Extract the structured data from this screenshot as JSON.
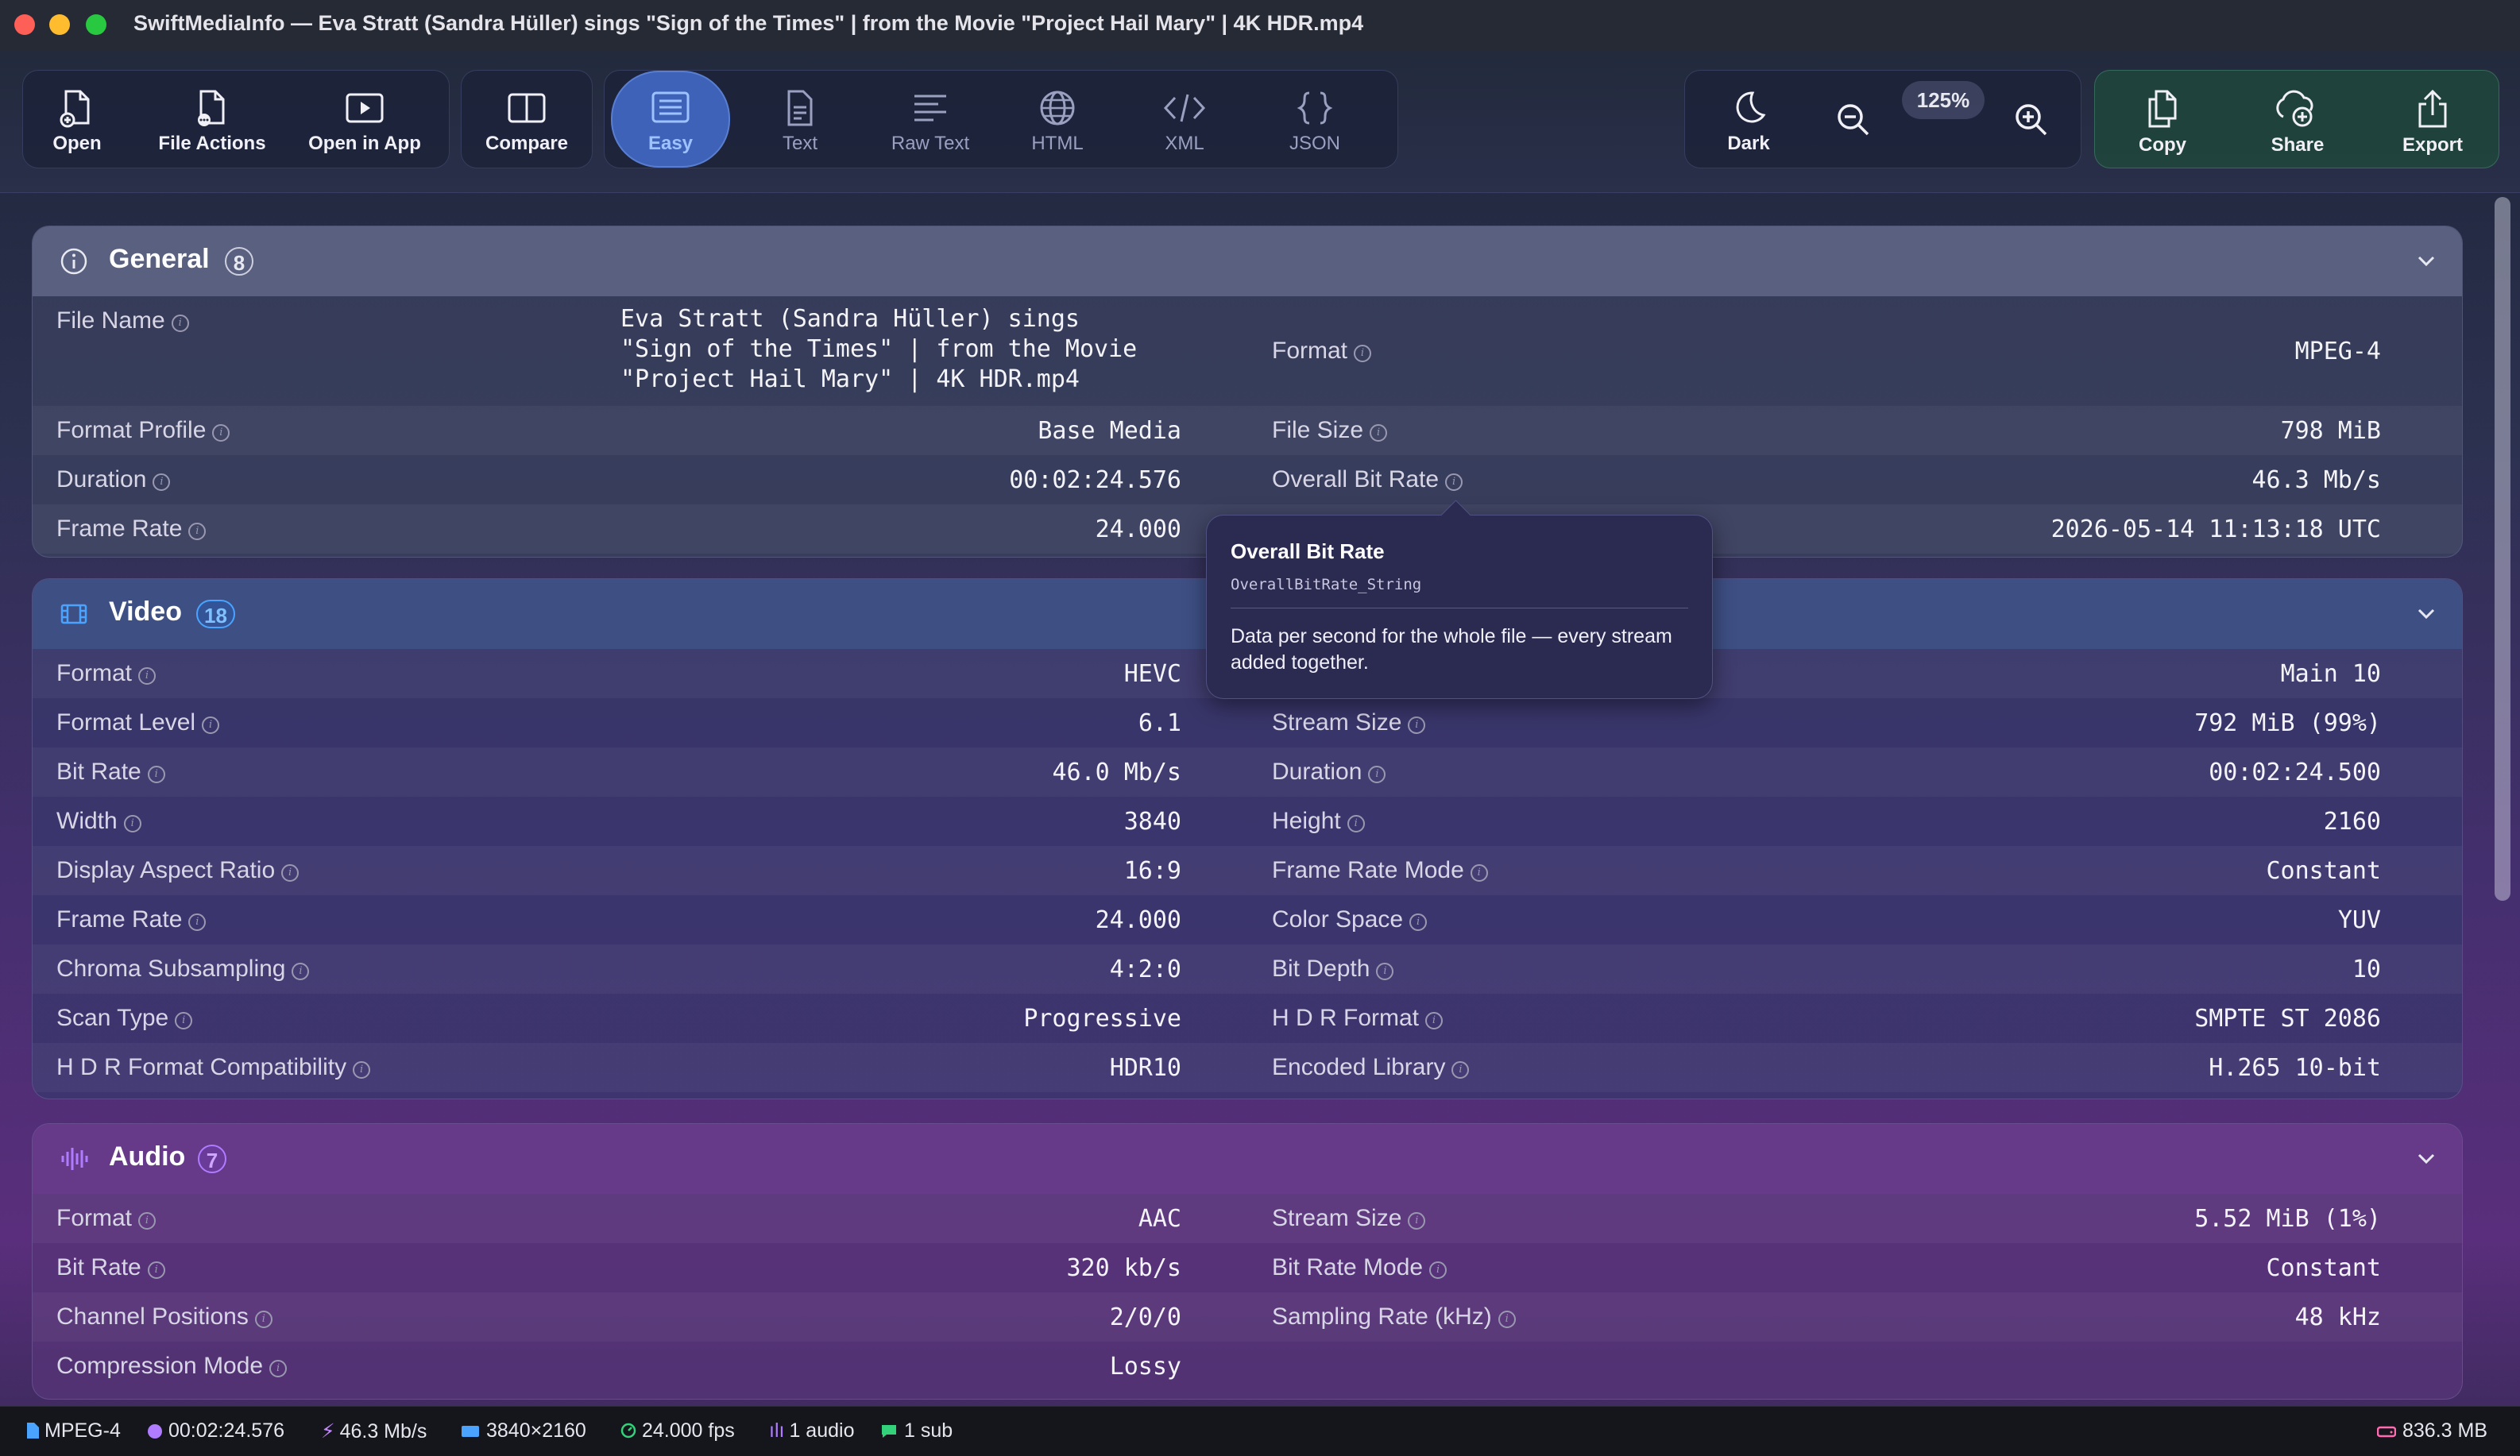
{
  "window": {
    "title": "SwiftMediaInfo — Eva Stratt (Sandra Hüller) sings \"Sign of the Times\" | from the Movie \"Project Hail Mary\" | 4K HDR.mp4"
  },
  "toolbar": {
    "open": "Open",
    "file_actions": "File Actions",
    "open_in_app": "Open in App",
    "compare": "Compare",
    "views": [
      "Easy",
      "Text",
      "Raw Text",
      "HTML",
      "XML",
      "JSON"
    ],
    "active_view": "Easy",
    "dark": "Dark",
    "zoom": "125%",
    "copy": "Copy",
    "share": "Share",
    "export": "Export"
  },
  "general": {
    "title": "General",
    "count": "8",
    "file_name_label": "File Name",
    "file_name_lines": [
      "Eva Stratt (Sandra Hüller) sings",
      "\"Sign of the Times\" | from the Movie",
      "\"Project Hail Mary\" | 4K HDR.mp4"
    ],
    "rows": [
      {
        "l1": "Format Profile",
        "v1": "Base Media",
        "l2": "File Size",
        "v2": "798 MiB"
      },
      {
        "l1": "Duration",
        "v1": "00:02:24.576",
        "l2": "Overall Bit Rate",
        "v2": "46.3 Mb/s"
      },
      {
        "l1": "Frame Rate",
        "v1": "24.000",
        "l2": "",
        "v2": "2026-05-14 11:13:18 UTC"
      }
    ],
    "format_label": "Format",
    "format_value": "MPEG-4"
  },
  "video": {
    "title": "Video",
    "count": "18",
    "rows": [
      {
        "l1": "Format",
        "v1": "HEVC",
        "l2": "",
        "v2": "Main 10"
      },
      {
        "l1": "Format Level",
        "v1": "6.1",
        "l2": "Stream Size",
        "v2": "792 MiB (99%)"
      },
      {
        "l1": "Bit Rate",
        "v1": "46.0 Mb/s",
        "l2": "Duration",
        "v2": "00:02:24.500"
      },
      {
        "l1": "Width",
        "v1": "3840",
        "l2": "Height",
        "v2": "2160"
      },
      {
        "l1": "Display Aspect Ratio",
        "v1": "16:9",
        "l2": "Frame Rate Mode",
        "v2": "Constant"
      },
      {
        "l1": "Frame Rate",
        "v1": "24.000",
        "l2": "Color Space",
        "v2": "YUV"
      },
      {
        "l1": "Chroma Subsampling",
        "v1": "4:2:0",
        "l2": "Bit Depth",
        "v2": "10"
      },
      {
        "l1": "Scan Type",
        "v1": "Progressive",
        "l2": "H D R Format",
        "v2": "SMPTE ST 2086"
      },
      {
        "l1": "H D R Format Compatibility",
        "v1": "HDR10",
        "l2": "Encoded Library",
        "v2": "H.265 10-bit"
      }
    ]
  },
  "audio": {
    "title": "Audio",
    "count": "7",
    "rows": [
      {
        "l1": "Format",
        "v1": "AAC",
        "l2": "Stream Size",
        "v2": "5.52 MiB (1%)"
      },
      {
        "l1": "Bit Rate",
        "v1": "320 kb/s",
        "l2": "Bit Rate Mode",
        "v2": "Constant"
      },
      {
        "l1": "Channel Positions",
        "v1": "2/0/0",
        "l2": "Sampling Rate (kHz)",
        "v2": "48 kHz"
      },
      {
        "l1": "Compression Mode",
        "v1": "Lossy",
        "l2": "",
        "v2": ""
      }
    ]
  },
  "tooltip": {
    "title": "Overall Bit Rate",
    "key": "OverallBitRate_String",
    "description": "Data per second for the whole file — every stream added together."
  },
  "status": {
    "format": "MPEG-4",
    "duration": "00:02:24.576",
    "bitrate": "46.3 Mb/s",
    "resolution": "3840×2160",
    "fps": "24.000 fps",
    "audio": "1 audio",
    "sub": "1 sub",
    "size": "836.3 MB"
  },
  "colors": {
    "accent_blue": "#3e62b8",
    "video_badge": "#4aa3ff",
    "audio_badge": "#b07cff"
  }
}
